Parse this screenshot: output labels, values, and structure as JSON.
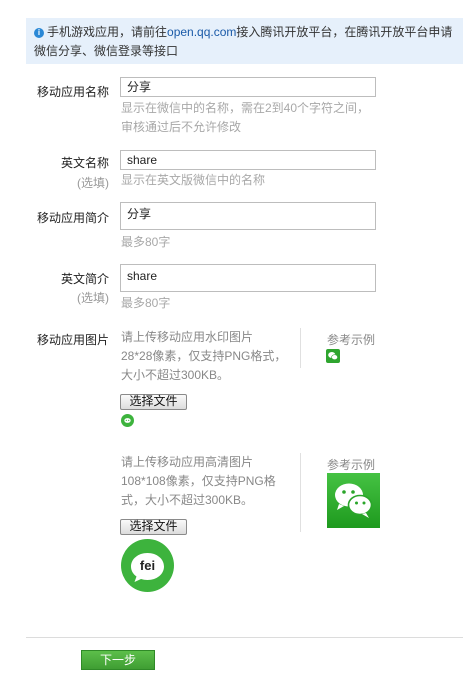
{
  "notice": {
    "text_before": "手机游戏应用，请前往",
    "link": "open.qq.com",
    "text_after": "接入腾讯开放平台，在腾讯开放平台申请微信分享、微信登录等接口"
  },
  "form": {
    "app_name": {
      "label": "移动应用名称",
      "value": "分享",
      "hint_line1": "显示在微信中的名称，需在2到40个字符之间，",
      "hint_line2": "审核通过后不允许修改"
    },
    "english_name": {
      "label": "英文名称",
      "optional": "(选填)",
      "value": "share",
      "hint": "显示在英文版微信中的名称"
    },
    "app_intro": {
      "label": "移动应用简介",
      "value": "分享",
      "hint": "最多80字"
    },
    "english_intro": {
      "label": "英文简介",
      "optional": "(选填)",
      "value": "share",
      "hint": "最多80字"
    },
    "app_image": {
      "label": "移动应用图片",
      "watermark": {
        "desc_line1": "请上传移动应用水印图片",
        "desc_line2": "28*28像素，仅支持PNG格式，",
        "desc_line3": "大小不超过300KB。",
        "button": "选择文件",
        "ref_label": "参考示例"
      },
      "hd": {
        "desc_line1": "请上传移动应用高清图片",
        "desc_line2": "108*108像素，仅支持PNG格",
        "desc_line3": "式，大小不超过300KB。",
        "button": "选择文件",
        "ref_label": "参考示例",
        "preview_text": "fei"
      }
    }
  },
  "next_button": "下一步",
  "colors": {
    "notice_bg": "#e6f0fb",
    "link": "#1a5aa8",
    "brand_green": "#3db33d",
    "button_green": "#4caf3e"
  }
}
